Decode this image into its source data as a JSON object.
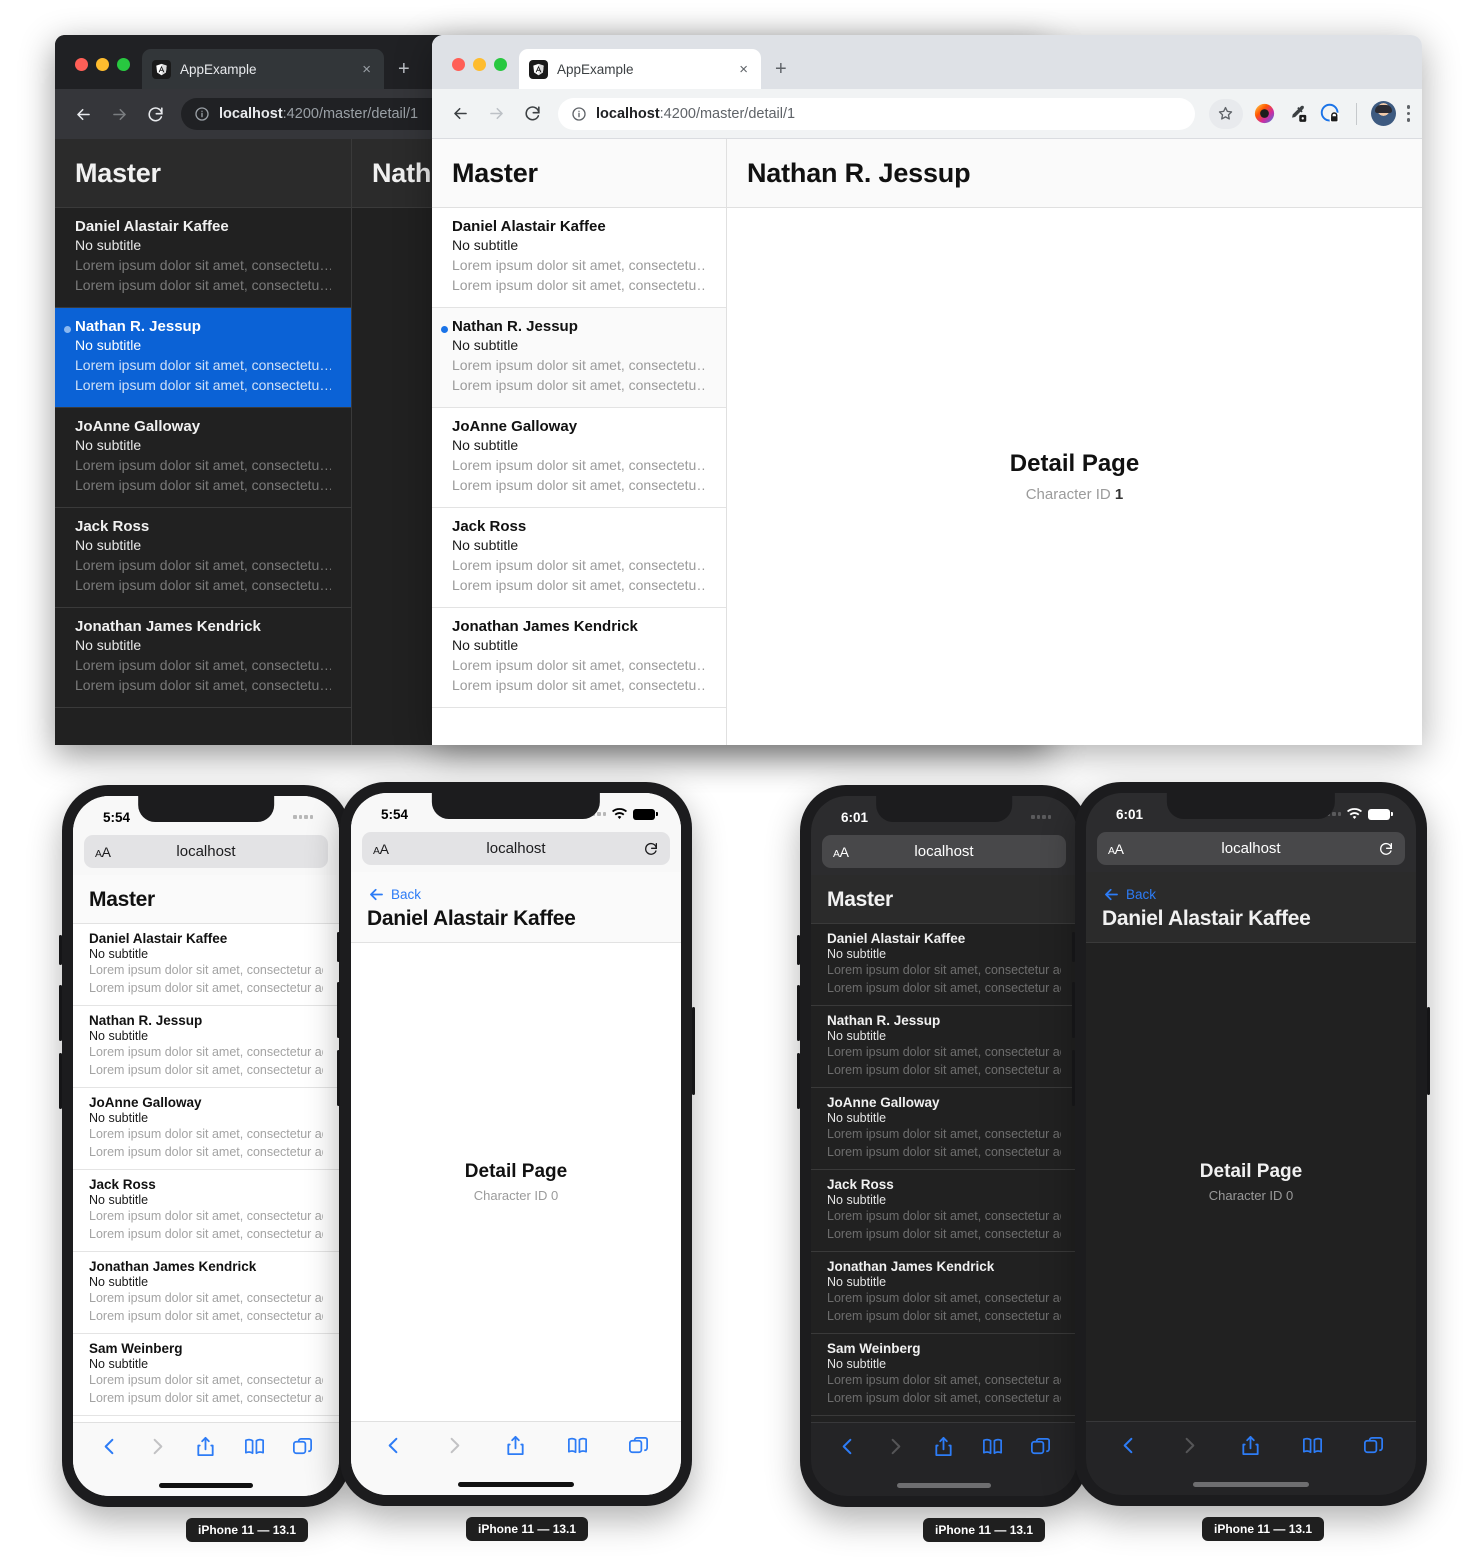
{
  "app": {
    "tab_title": "AppExample",
    "url_host": "localhost",
    "url_path": ":4200/master/detail/1",
    "master_title": "Master",
    "detail_heading": "Detail Page",
    "character_id_label": "Character ID",
    "no_subtitle": "No subtitle",
    "lorem_truncated": "Lorem ipsum dolor sit amet, consectetu…",
    "lorem_phone": "Lorem ipsum dolor sit amet, consectetur adipiscing",
    "lorem_phone_dark": "Lorem ipsum dolor sit amet, consectetur adipiscin",
    "back_label": "Back",
    "new_tab_label": "+",
    "close_tab_label": "×"
  },
  "characters": [
    {
      "name": "Daniel Alastair Kaffee",
      "id": "0"
    },
    {
      "name": "Nathan R. Jessup",
      "id": "1"
    },
    {
      "name": "JoAnne Galloway",
      "id": "2"
    },
    {
      "name": "Jack Ross",
      "id": "3"
    },
    {
      "name": "Jonathan James Kendrick",
      "id": "4"
    },
    {
      "name": "Sam Weinberg",
      "id": "5"
    }
  ],
  "browser_dark": {
    "theme": "dark",
    "tab_title": "AppExample",
    "url_host": "localhost",
    "url_path": ":4200/master/detail/1",
    "master_title": "Master",
    "detail_title": "Natha",
    "selected_character": "Nathan R. Jessup",
    "selected_index": 1
  },
  "browser_light": {
    "theme": "light",
    "tab_title": "AppExample",
    "url_host": "localhost",
    "url_path": ":4200/master/detail/1",
    "master_title": "Master",
    "detail_title": "Nathan R. Jessup",
    "detail_heading": "Detail Page",
    "character_id_label": "Character ID",
    "character_id_value": "1",
    "selected_index": 1,
    "toolbar_icons": [
      "star-icon",
      "extension-color-icon",
      "eyedropper-icon",
      "privacy-lock-icon",
      "profile-avatar",
      "kebab-menu-icon"
    ]
  },
  "phones": [
    {
      "id": "phone-light-master",
      "theme": "light",
      "time": "5:54",
      "safari_url": "localhost",
      "text_size_label": "AA",
      "page_title": "Master",
      "device_label": "iPhone 11 — 13.1",
      "view": "master"
    },
    {
      "id": "phone-light-detail",
      "theme": "light",
      "time": "5:54",
      "safari_url": "localhost",
      "text_size_label": "AA",
      "back_label": "Back",
      "page_title": "Daniel Alastair Kaffee",
      "detail_heading": "Detail Page",
      "character_id_label": "Character ID",
      "character_id_value": "0",
      "device_label": "iPhone 11 — 13.1",
      "view": "detail"
    },
    {
      "id": "phone-dark-master",
      "theme": "dark",
      "time": "6:01",
      "safari_url": "localhost",
      "text_size_label": "AA",
      "page_title": "Master",
      "device_label": "iPhone 11 — 13.1",
      "view": "master"
    },
    {
      "id": "phone-dark-detail",
      "theme": "dark",
      "time": "6:01",
      "safari_url": "localhost",
      "text_size_label": "AA",
      "back_label": "Back",
      "page_title": "Daniel Alastair Kaffee",
      "detail_heading": "Detail Page",
      "character_id_label": "Character ID",
      "character_id_value": "0",
      "device_label": "iPhone 11 — 13.1",
      "view": "detail"
    }
  ],
  "colors": {
    "accent_blue": "#0b62d6",
    "link_blue": "#2d7cf6",
    "dark_bg": "#212121",
    "dark_header": "#2b2b2b",
    "chrome_dark_toolbar": "#35363a",
    "chrome_light_toolbar": "#f1f3f4"
  }
}
